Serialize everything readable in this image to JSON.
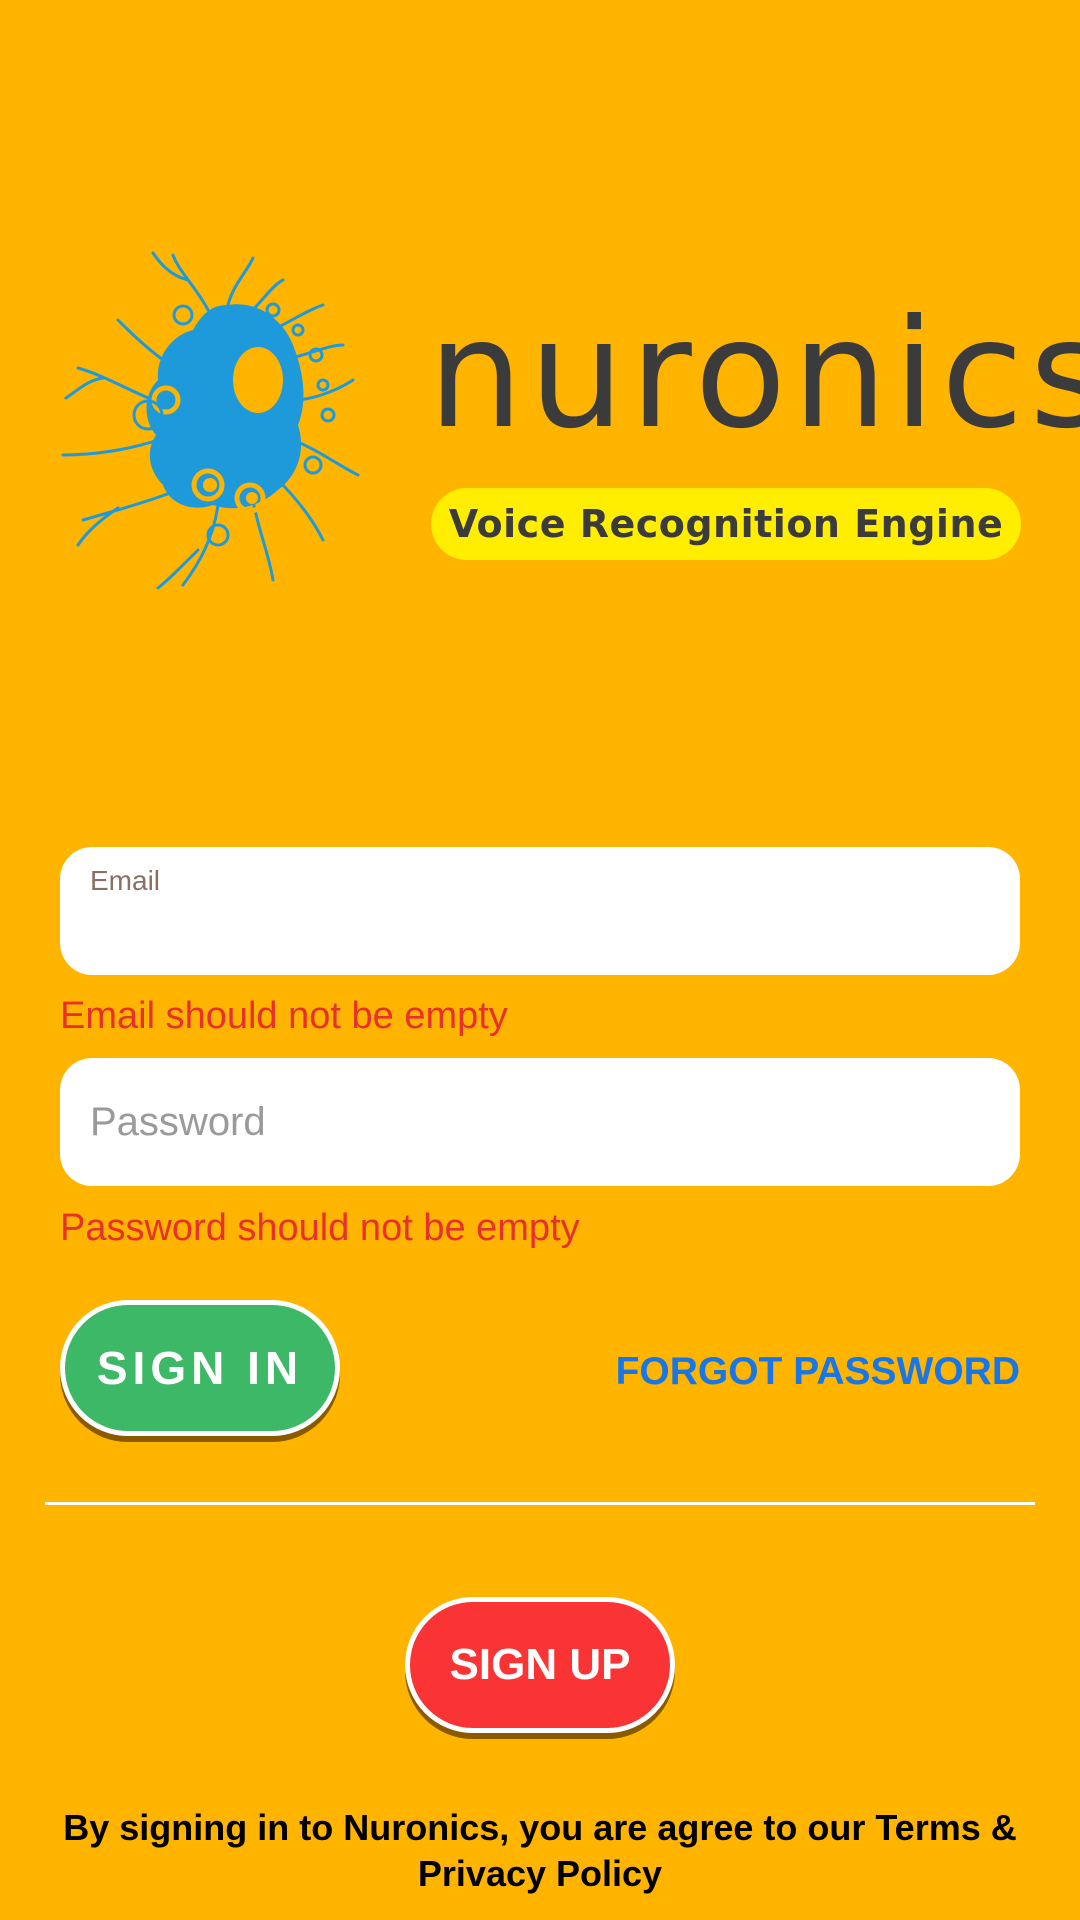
{
  "logo": {
    "wordmark": "nuronics",
    "tagline": "Voice Recognition Engine",
    "mark_icon": "neuron-splash-icon"
  },
  "login_form": {
    "email": {
      "label": "Email",
      "value": "",
      "error": "Email should not be empty"
    },
    "password": {
      "placeholder": "Password",
      "value": "",
      "error": "Password should not be empty"
    },
    "sign_in_label": "SIGN IN",
    "forgot_password_label": "FORGOT PASSWORD"
  },
  "sign_up_label": "SIGN UP",
  "terms_text": "By signing in to Nuronics, you are agree to our Terms & Privacy Policy",
  "colors": {
    "background": "#FFB400",
    "sign_in": "#3DB866",
    "sign_up": "#FA3434",
    "link": "#1877E8",
    "error": "#E8312A",
    "logo_blue": "#1E9ADB",
    "tagline_bg": "#FFEE00"
  }
}
